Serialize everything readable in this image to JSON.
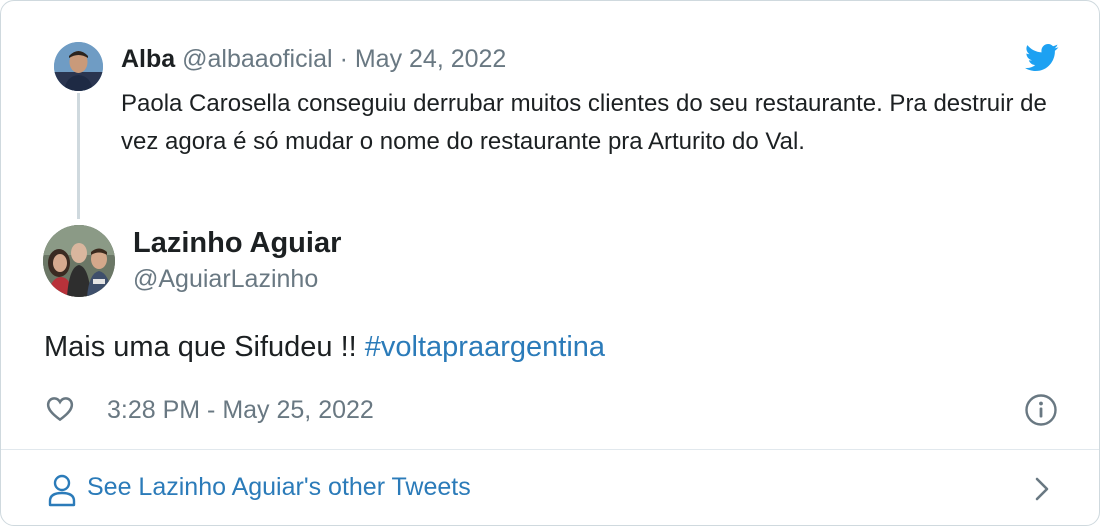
{
  "parent_tweet": {
    "author_name": "Alba",
    "author_handle": "@albaaoficial",
    "separator": "·",
    "date": "May 24, 2022",
    "text": "Paola Carosella conseguiu derrubar muitos clientes do seu restaurante. Pra destruir de vez agora é só mudar o nome do restaurante pra Arturito do Val."
  },
  "tweet": {
    "author_name": "Lazinho Aguiar",
    "author_handle": "@AguiarLazinho",
    "text": "Mais uma que Sifudeu  !! ",
    "hashtag": "#voltapraargentina",
    "timestamp": "3:28 PM - May 25, 2022"
  },
  "footer": {
    "link_label": "See Lazinho Aguiar's other Tweets"
  },
  "icons": {
    "brand": "twitter-bird-icon",
    "like": "heart-icon",
    "info": "info-icon",
    "profile": "person-icon",
    "navigate": "chevron-right-icon"
  },
  "colors": {
    "twitter_blue": "#1da1f2",
    "link_blue": "#2b7bb9",
    "muted_gray": "#697882",
    "text_dark": "#1c2022",
    "border": "#cfd9de"
  }
}
